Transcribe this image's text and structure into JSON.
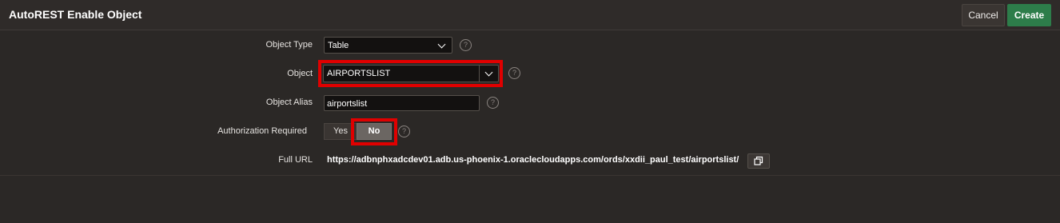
{
  "dialog": {
    "title": "AutoREST Enable Object",
    "cancel_label": "Cancel",
    "create_label": "Create"
  },
  "form": {
    "object_type": {
      "label": "Object Type",
      "value": "Table"
    },
    "object": {
      "label": "Object",
      "value": "AIRPORTSLIST"
    },
    "object_alias": {
      "label": "Object Alias",
      "value": "airportslist"
    },
    "authorization": {
      "label": "Authorization Required",
      "yes_label": "Yes",
      "no_label": "No",
      "selected": "No"
    },
    "full_url": {
      "label": "Full URL",
      "value": "https://adbnphxadcdev01.adb.us-phoenix-1.oraclecloudapps.com/ords/xxdii_paul_test/airportslist/"
    }
  },
  "help_glyph": "?",
  "colors": {
    "background": "#2b2826",
    "create_button": "#2d7d4a",
    "highlight": "#e00000",
    "toggle_selected": "#6b6662"
  }
}
